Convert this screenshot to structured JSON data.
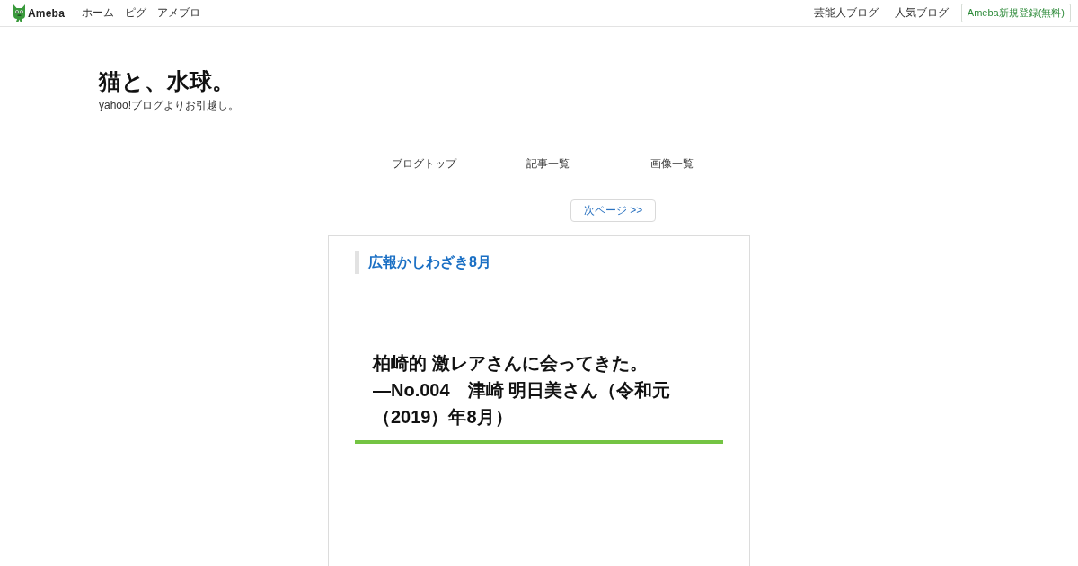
{
  "header": {
    "logo": "Ameba",
    "nav": [
      "ホーム",
      "ピグ",
      "アメブロ"
    ],
    "links": [
      "芸能人ブログ",
      "人気ブログ"
    ],
    "signup": "Ameba新規登録(無料)"
  },
  "blog": {
    "title": "猫と、水球。",
    "description": "yahoo!ブログよりお引越し。"
  },
  "blog_nav": [
    "ブログトップ",
    "記事一覧",
    "画像一覧"
  ],
  "pager": {
    "next": "次ページ >>"
  },
  "article": {
    "category": "広報かしわざき8月",
    "heading_lines": [
      "柏崎的 激レアさんに会ってきた。",
      "—No.004　津崎 明日美さん（令和元（2019）年8月）"
    ]
  }
}
